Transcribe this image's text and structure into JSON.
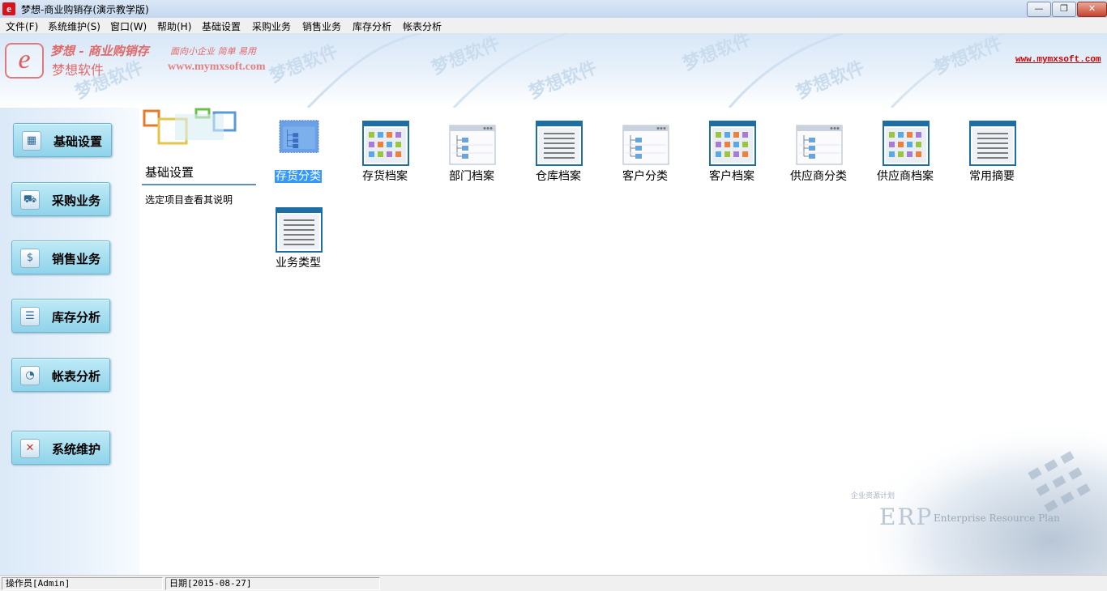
{
  "window": {
    "title": "梦想-商业购销存(演示教学版)",
    "app_icon_letter": "e",
    "minimize_glyph": "—",
    "maximize_glyph": "❐",
    "close_glyph": "✕"
  },
  "menu": [
    {
      "id": "file",
      "label": "文件(F)"
    },
    {
      "id": "system-maintain",
      "label": "系统维护(S)"
    },
    {
      "id": "window",
      "label": "窗口(W)"
    },
    {
      "id": "help",
      "label": "帮助(H)"
    },
    {
      "id": "basic-settings",
      "label": "基础设置"
    },
    {
      "id": "purchase",
      "label": "采购业务"
    },
    {
      "id": "sales",
      "label": "销售业务"
    },
    {
      "id": "inventory-analysis",
      "label": "库存分析"
    },
    {
      "id": "report-analysis",
      "label": "帐表分析"
    }
  ],
  "banner": {
    "slogan": "梦想 - 商业购销存",
    "subslogan": "面向小企业 简单 易用",
    "brand": "梦想软件",
    "url": "www.mymxsoft.com",
    "url_right": "www.mymxsoft.com",
    "watermark": "梦想软件"
  },
  "sidebar": {
    "items": [
      {
        "id": "basic-settings",
        "label": "基础设置",
        "icon": "grid-icon"
      },
      {
        "id": "purchase",
        "label": "采购业务",
        "icon": "cart-icon"
      },
      {
        "id": "sales",
        "label": "销售业务",
        "icon": "coin-icon"
      },
      {
        "id": "inventory-analysis",
        "label": "库存分析",
        "icon": "database-icon"
      },
      {
        "id": "report-analysis",
        "label": "帐表分析",
        "icon": "pie-chart-icon"
      },
      {
        "id": "system-maintain",
        "label": "系统维护",
        "icon": "tools-icon"
      }
    ]
  },
  "panel": {
    "title": "基础设置",
    "description": "选定项目查看其说明"
  },
  "modules": [
    {
      "id": "inventory-category",
      "label": "存货分类",
      "icon": "tree-icon",
      "selected": true
    },
    {
      "id": "inventory-records",
      "label": "存货档案",
      "icon": "grid-icon",
      "selected": false
    },
    {
      "id": "department-records",
      "label": "部门档案",
      "icon": "tree-icon",
      "selected": false
    },
    {
      "id": "warehouse-records",
      "label": "仓库档案",
      "icon": "list-icon",
      "selected": false
    },
    {
      "id": "customer-category",
      "label": "客户分类",
      "icon": "tree-icon",
      "selected": false
    },
    {
      "id": "customer-records",
      "label": "客户档案",
      "icon": "grid-icon",
      "selected": false
    },
    {
      "id": "supplier-category",
      "label": "供应商分类",
      "icon": "tree-icon",
      "selected": false
    },
    {
      "id": "supplier-records",
      "label": "供应商档案",
      "icon": "grid-icon",
      "selected": false
    },
    {
      "id": "common-summary",
      "label": "常用摘要",
      "icon": "list-icon",
      "selected": false
    },
    {
      "id": "business-type",
      "label": "业务类型",
      "icon": "list-icon",
      "selected": false
    }
  ],
  "erp_watermark": {
    "cn": "企业资源计划",
    "letters": "ERP",
    "full": "Enterprise Resource Plan"
  },
  "statusbar": {
    "operator": "操作员[Admin]",
    "date": "日期[2015-08-27]"
  }
}
